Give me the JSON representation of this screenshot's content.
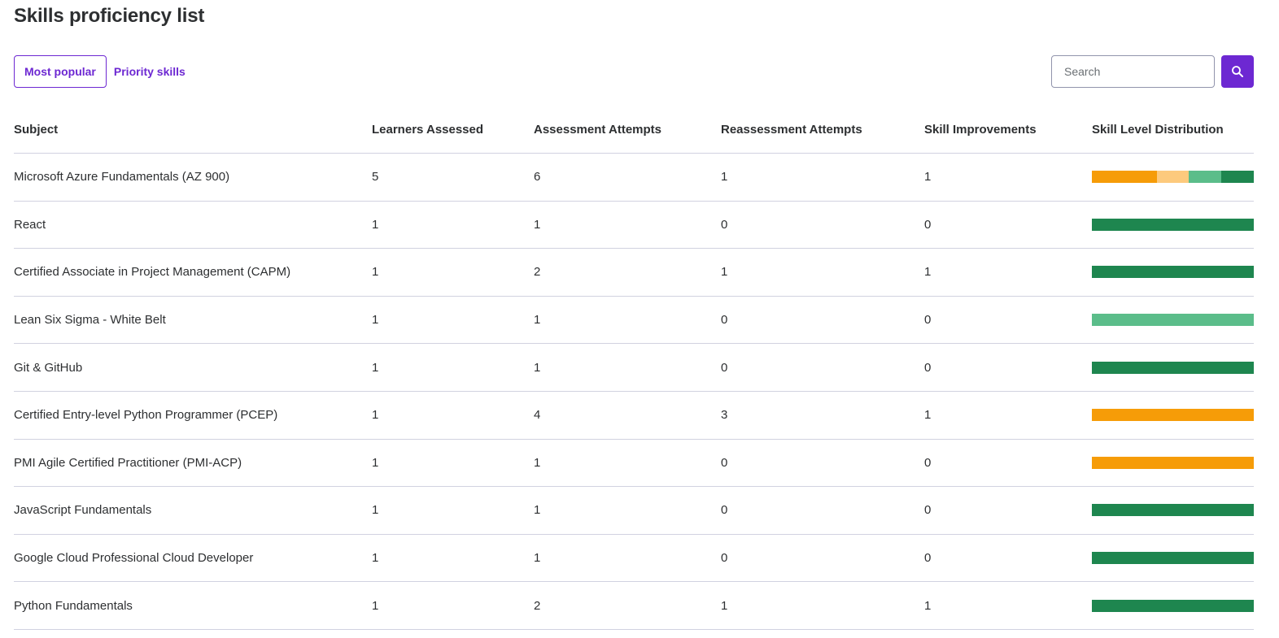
{
  "page": {
    "title": "Skills proficiency list"
  },
  "filters": {
    "most_popular": "Most popular",
    "priority_skills": "Priority skills"
  },
  "search": {
    "placeholder": "Search"
  },
  "colors": {
    "accent": "#6d28d2",
    "level_1": "#f69c08",
    "level_2": "#fdca7d",
    "level_3": "#5bbd8a",
    "level_4": "#1e864f"
  },
  "table": {
    "columns": {
      "subject": "Subject",
      "learners": "Learners Assessed",
      "attempts": "Assessment Attempts",
      "reassess": "Reassessment Attempts",
      "improve": "Skill Improvements",
      "dist": "Skill Level Distribution"
    },
    "rows": [
      {
        "subject": "Microsoft Azure Fundamentals (AZ 900)",
        "learners": "5",
        "attempts": "6",
        "reassess": "1",
        "improve": "1",
        "distribution": [
          0.4,
          0.2,
          0.2,
          0.2
        ]
      },
      {
        "subject": "React",
        "learners": "1",
        "attempts": "1",
        "reassess": "0",
        "improve": "0",
        "distribution": [
          0,
          0,
          0,
          1
        ]
      },
      {
        "subject": "Certified Associate in Project Management (CAPM)",
        "learners": "1",
        "attempts": "2",
        "reassess": "1",
        "improve": "1",
        "distribution": [
          0,
          0,
          0,
          1
        ]
      },
      {
        "subject": "Lean Six Sigma - White Belt",
        "learners": "1",
        "attempts": "1",
        "reassess": "0",
        "improve": "0",
        "distribution": [
          0,
          0,
          1,
          0
        ]
      },
      {
        "subject": "Git & GitHub",
        "learners": "1",
        "attempts": "1",
        "reassess": "0",
        "improve": "0",
        "distribution": [
          0,
          0,
          0,
          1
        ]
      },
      {
        "subject": "Certified Entry-level Python Programmer (PCEP)",
        "learners": "1",
        "attempts": "4",
        "reassess": "3",
        "improve": "1",
        "distribution": [
          1,
          0,
          0,
          0
        ]
      },
      {
        "subject": "PMI Agile Certified Practitioner (PMI-ACP)",
        "learners": "1",
        "attempts": "1",
        "reassess": "0",
        "improve": "0",
        "distribution": [
          1,
          0,
          0,
          0
        ]
      },
      {
        "subject": "JavaScript Fundamentals",
        "learners": "1",
        "attempts": "1",
        "reassess": "0",
        "improve": "0",
        "distribution": [
          0,
          0,
          0,
          1
        ]
      },
      {
        "subject": "Google Cloud Professional Cloud Developer",
        "learners": "1",
        "attempts": "1",
        "reassess": "0",
        "improve": "0",
        "distribution": [
          0,
          0,
          0,
          1
        ]
      },
      {
        "subject": "Python Fundamentals",
        "learners": "1",
        "attempts": "2",
        "reassess": "1",
        "improve": "1",
        "distribution": [
          0,
          0,
          0,
          1
        ]
      }
    ]
  }
}
